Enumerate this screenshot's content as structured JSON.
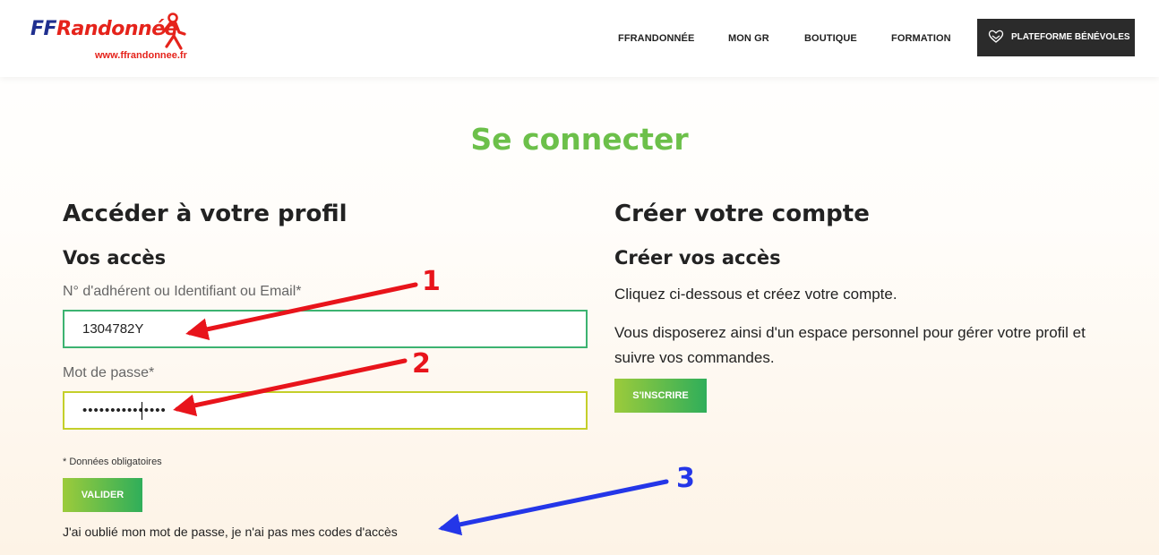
{
  "header": {
    "logo": {
      "brand_ff": "FF",
      "brand_name": "Randonnée",
      "url": "www.ffrandonnee.fr"
    },
    "nav": [
      {
        "label": "FFRANDONNÉE"
      },
      {
        "label": "MON GR"
      },
      {
        "label": "BOUTIQUE"
      },
      {
        "label": "FORMATION"
      }
    ],
    "volunteer_button": {
      "label": "PLATEFORME BÉNÉVOLES",
      "icon": "heart-hands-icon"
    }
  },
  "page_title": "Se connecter",
  "login": {
    "heading": "Accéder à votre profil",
    "subheading": "Vos accès",
    "id_label": "N° d'adhérent ou Identifiant ou Email*",
    "id_value": "1304782Y",
    "password_label": "Mot de passe*",
    "password_value": "•••••••••••••••",
    "required_note": "* Données obligatoires",
    "submit_label": "VALIDER",
    "forgot_link": "J'ai oublié mon mot de passe, je n'ai pas mes codes d'accès"
  },
  "signup": {
    "heading": "Créer votre compte",
    "subheading": "Créer vos accès",
    "text_1": "Cliquez ci-dessous et créez votre compte.",
    "text_2": "Vous disposerez ainsi d'un espace personnel pour gérer votre profil et suivre vos commandes.",
    "button_label": "S'INSCRIRE"
  },
  "annotations": [
    {
      "number": "1",
      "color": "#e8141b"
    },
    {
      "number": "2",
      "color": "#e8141b"
    },
    {
      "number": "3",
      "color": "#2436e8"
    }
  ],
  "colors": {
    "title_green": "#6cc04a",
    "brand_blue": "#1f2f8f",
    "brand_red": "#e5231b",
    "button_gradient_start": "#9ccb3b",
    "button_gradient_end": "#2fae5a",
    "id_border": "#3cb371",
    "password_border": "#c4cf2a",
    "volunteer_bg": "#2b2b2b"
  }
}
